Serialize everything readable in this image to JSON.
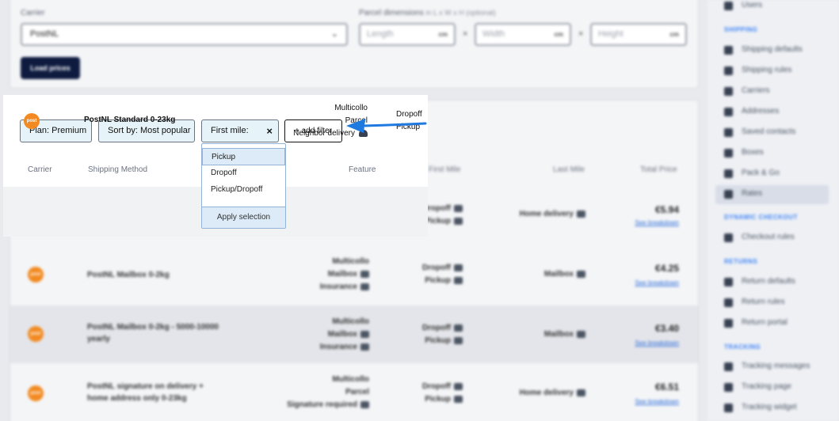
{
  "shipping_form": {
    "carrier_label": "Carrier",
    "carrier_value": "PostNL",
    "parcel_label": "Parcel dimensions",
    "parcel_label_optional": "in L x W x H (optional)",
    "length_placeholder": "Length",
    "width_placeholder": "Width",
    "height_placeholder": "Height",
    "unit": "cm",
    "times": "×",
    "load_prices_label": "Load prices"
  },
  "filters": {
    "plan_chip": "Plan: Premium",
    "sort_chip": "Sort by: Most popular",
    "first_mile_chip": "First mile:",
    "clear_symbol": "×",
    "add_filter": "+ add filter"
  },
  "dropdown": {
    "options": [
      "Pickup",
      "Dropoff",
      "Pickup/Dropoff"
    ],
    "highlighted_index": 0,
    "apply_label": "Apply selection"
  },
  "table": {
    "headers": {
      "carrier": "Carrier",
      "method": "Shipping Method",
      "feature": "Feature",
      "first_mile": "First Mile",
      "last_mile": "Last Mile",
      "total_price": "Total Price"
    },
    "logo_text": "post",
    "see_breakdown": "See breakdown",
    "rows": [
      {
        "method": "PostNL Standard 0-23kg",
        "features": [
          "Multicollo",
          "Parcel",
          "Neighbor delivery"
        ],
        "first_mile": [
          "Dropoff",
          "Pickup"
        ],
        "last_mile": "Home delivery",
        "price": "€5.94"
      },
      {
        "method": "PostNL Mailbox 0-2kg",
        "features": [
          "Multicollo",
          "Mailbox",
          "Insurance"
        ],
        "first_mile": [
          "Dropoff",
          "Pickup"
        ],
        "last_mile": "Mailbox",
        "price": "€4.25"
      },
      {
        "method": "PostNL Mailbox 0-2kg - 5000-10000 yearly",
        "features": [
          "Multicollo",
          "Mailbox",
          "Insurance"
        ],
        "first_mile": [
          "Dropoff",
          "Pickup"
        ],
        "last_mile": "Mailbox",
        "price": "€3.40"
      },
      {
        "method": "PostNL signature on delivery + home address only 0-23kg",
        "features": [
          "Multicollo",
          "Parcel",
          "Signature required"
        ],
        "first_mile": [
          "Dropoff",
          "Pickup"
        ],
        "last_mile": "Home delivery",
        "price": "€6.51"
      }
    ]
  },
  "sidebar": {
    "users": "Users",
    "shipping_header": "SHIPPING",
    "shipping_items": [
      "Shipping defaults",
      "Shipping rules",
      "Carriers",
      "Addresses",
      "Saved contacts",
      "Boxes",
      "Pack & Go",
      "Rates"
    ],
    "dynamic_header": "DYNAMIC CHECKOUT",
    "dynamic_items": [
      "Checkout rules"
    ],
    "returns_header": "RETURNS",
    "returns_items": [
      "Return defaults",
      "Return rules",
      "Return portal"
    ],
    "tracking_header": "TRACKING",
    "tracking_items": [
      "Tracking messages",
      "Tracking page",
      "Tracking widget"
    ],
    "active_item": "Rates"
  },
  "colors": {
    "accent_blue": "#1f7ae0",
    "chip_bg": "#e6f3f8",
    "navy_button": "#0e1b3f",
    "postnl_orange": "#f28a21"
  }
}
